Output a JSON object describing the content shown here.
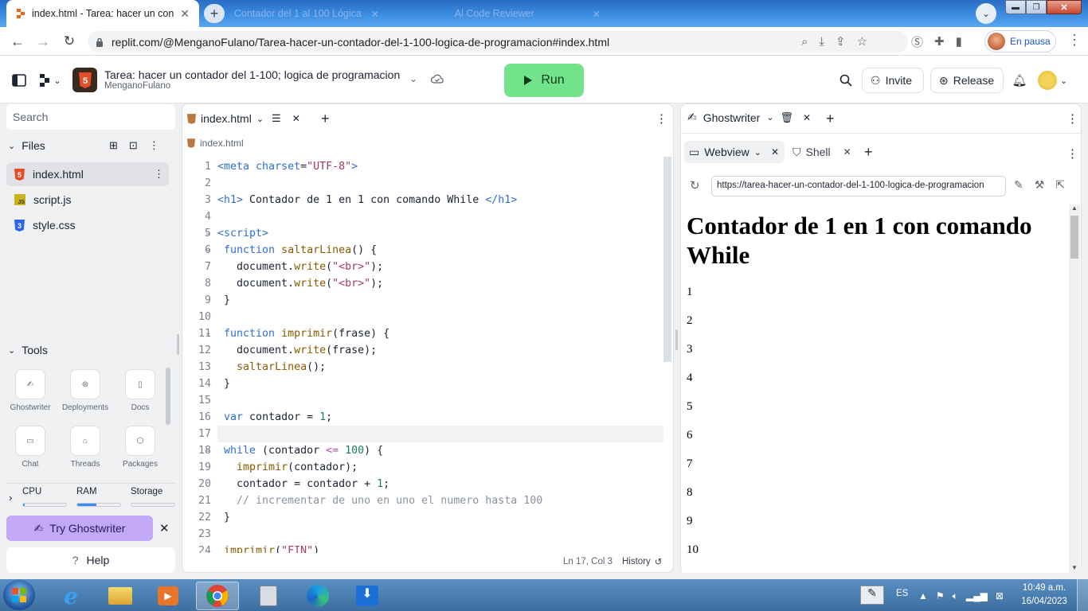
{
  "browser": {
    "active_tab_title": "index.html - Tarea: hacer un contador",
    "tab2_title": "Contador del 1 al 100 Lógica d",
    "tab3_title": "Al Code Reviewer",
    "url": "replit.com/@MenganoFulano/Tarea-hacer-un-contador-del-1-100-logica-de-programacion#index.html",
    "profile_label": "En pausa"
  },
  "header": {
    "repl_title": "Tarea: hacer un contador del 1-100; logica de programacion",
    "owner": "MenganoFulano",
    "run_label": "Run",
    "invite_label": "Invite",
    "release_label": "Release"
  },
  "sidebar": {
    "search_placeholder": "Search",
    "files_label": "Files",
    "files": [
      {
        "name": "index.html",
        "icon": "html5-icon"
      },
      {
        "name": "script.js",
        "icon": "js-icon"
      },
      {
        "name": "style.css",
        "icon": "css3-icon"
      }
    ],
    "tools_label": "Tools",
    "tools": [
      "Ghostwriter",
      "Deployments",
      "Docs",
      "Chat",
      "Threads",
      "Packages"
    ],
    "resources": {
      "cpu_label": "CPU",
      "ram_label": "RAM",
      "storage_label": "Storage",
      "cpu_usage": 0.04,
      "ram_usage": 0.45,
      "storage_usage": 0.0
    },
    "try_ghostwriter": "Try Ghostwriter",
    "help": "Help"
  },
  "editor": {
    "tab_label": "index.html",
    "breadcrumb": "index.html",
    "status_position": "Ln 17, Col 3",
    "history_label": "History",
    "lines": [
      {
        "n": "1",
        "tokens": [
          [
            "tag",
            "<meta "
          ],
          [
            "kw",
            "charset"
          ],
          [
            "",
            "="
          ],
          [
            "str",
            "\"UTF-8\""
          ],
          [
            "tag",
            ">"
          ]
        ]
      },
      {
        "n": "2",
        "tokens": []
      },
      {
        "n": "3",
        "tokens": [
          [
            "tag",
            "<h1>"
          ],
          [
            "",
            " Contador de 1 en 1 con comando While "
          ],
          [
            "tag",
            "</h1>"
          ]
        ]
      },
      {
        "n": "4",
        "tokens": []
      },
      {
        "n": "5",
        "tokens": [
          [
            "tag",
            "<script>"
          ]
        ]
      },
      {
        "n": "6",
        "tokens": [
          [
            "",
            " "
          ],
          [
            "kw",
            "function"
          ],
          [
            "",
            " "
          ],
          [
            "fn",
            "saltarLinea"
          ],
          [
            "",
            "() {"
          ]
        ]
      },
      {
        "n": "7",
        "tokens": [
          [
            "",
            "   document."
          ],
          [
            "fn",
            "write"
          ],
          [
            "",
            "("
          ],
          [
            "str",
            "\"<br>\""
          ],
          [
            "",
            ");"
          ]
        ]
      },
      {
        "n": "8",
        "tokens": [
          [
            "",
            "   document."
          ],
          [
            "fn",
            "write"
          ],
          [
            "",
            "("
          ],
          [
            "str",
            "\"<br>\""
          ],
          [
            "",
            ");"
          ]
        ]
      },
      {
        "n": "9",
        "tokens": [
          [
            "",
            " }"
          ]
        ]
      },
      {
        "n": "10",
        "tokens": []
      },
      {
        "n": "11",
        "tokens": [
          [
            "",
            " "
          ],
          [
            "kw",
            "function"
          ],
          [
            "",
            " "
          ],
          [
            "fn",
            "imprimir"
          ],
          [
            "",
            "(frase) {"
          ]
        ]
      },
      {
        "n": "12",
        "tokens": [
          [
            "",
            "   document."
          ],
          [
            "fn",
            "write"
          ],
          [
            "",
            "(frase);"
          ]
        ]
      },
      {
        "n": "13",
        "tokens": [
          [
            "",
            "   "
          ],
          [
            "fn",
            "saltarLinea"
          ],
          [
            "",
            "();"
          ]
        ]
      },
      {
        "n": "14",
        "tokens": [
          [
            "",
            " }"
          ]
        ]
      },
      {
        "n": "15",
        "tokens": []
      },
      {
        "n": "16",
        "tokens": [
          [
            "",
            " "
          ],
          [
            "kw",
            "var"
          ],
          [
            "",
            " contador = "
          ],
          [
            "num",
            "1"
          ],
          [
            "",
            ";"
          ]
        ]
      },
      {
        "n": "17",
        "tokens": []
      },
      {
        "n": "18",
        "tokens": [
          [
            "",
            " "
          ],
          [
            "kw",
            "while"
          ],
          [
            "",
            " (contador "
          ],
          [
            "op",
            "<="
          ],
          [
            "",
            " "
          ],
          [
            "num",
            "100"
          ],
          [
            "",
            ") {"
          ]
        ]
      },
      {
        "n": "19",
        "tokens": [
          [
            "",
            "   "
          ],
          [
            "fn",
            "imprimir"
          ],
          [
            "",
            "(contador);"
          ]
        ]
      },
      {
        "n": "20",
        "tokens": [
          [
            "",
            "   contador = contador + "
          ],
          [
            "num",
            "1"
          ],
          [
            "",
            ";"
          ]
        ]
      },
      {
        "n": "21",
        "tokens": [
          [
            "cm",
            "   // incrementar de uno en uno el numero hasta 100"
          ]
        ]
      },
      {
        "n": "22",
        "tokens": [
          [
            "",
            " }"
          ]
        ]
      },
      {
        "n": "23",
        "tokens": []
      },
      {
        "n": "24",
        "tokens": [
          [
            "",
            " "
          ],
          [
            "fn",
            "imprimir"
          ],
          [
            "",
            "("
          ],
          [
            "str",
            "\"FIN\""
          ],
          [
            "",
            ")"
          ]
        ]
      }
    ]
  },
  "right_pane": {
    "ghostwriter_tab": "Ghostwriter",
    "webview_tab": "Webview",
    "shell_tab": "Shell",
    "webview_url": "https://tarea-hacer-un-contador-del-1-100-logica-de-programacion",
    "page_heading": "Contador de 1 en 1 con comando While",
    "page_numbers": [
      "1",
      "2",
      "3",
      "4",
      "5",
      "6",
      "7",
      "8",
      "9",
      "10"
    ]
  },
  "taskbar": {
    "language": "ES",
    "time": "10:49 a.m.",
    "date": "16/04/2023"
  }
}
